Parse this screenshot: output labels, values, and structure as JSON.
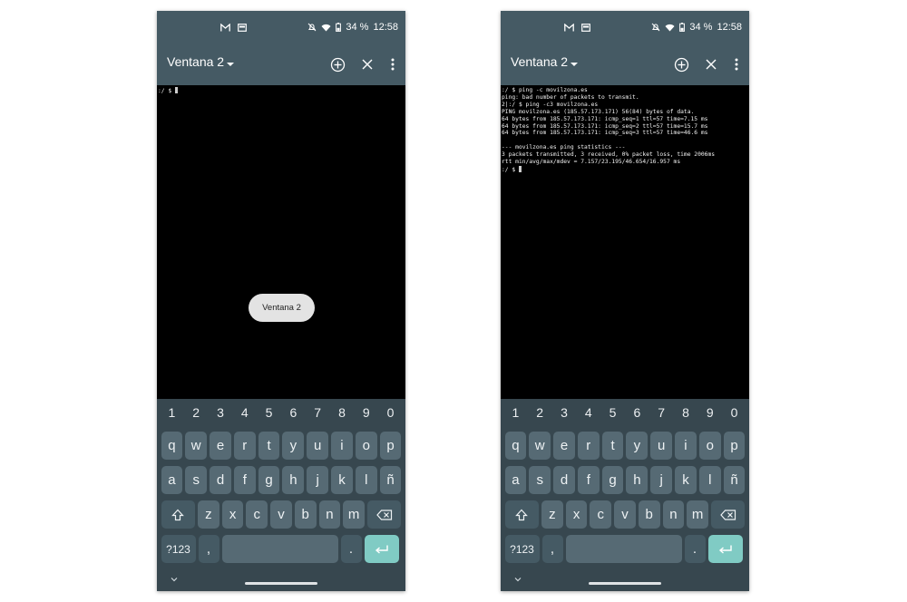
{
  "status_bar": {
    "battery": "34 %",
    "time": "12:58"
  },
  "toolbar": {
    "title": "Ventana 2"
  },
  "left_phone": {
    "terminal_lines": [
      ":/ $ "
    ],
    "toast": "Ventana 2"
  },
  "right_phone": {
    "terminal_lines": [
      ":/ $ ping -c movilzona.es",
      "ping: bad number of packets to transmit.",
      "2|:/ $ ping -c3 movilzona.es",
      "PING movilzona.es (185.57.173.171) 56(84) bytes of data.",
      "64 bytes from 185.57.173.171: icmp_seq=1 ttl=57 time=7.15 ms",
      "64 bytes from 185.57.173.171: icmp_seq=2 ttl=57 time=15.7 ms",
      "64 bytes from 185.57.173.171: icmp_seq=3 ttl=57 time=46.6 ms",
      "",
      "--- movilzona.es ping statistics ---",
      "3 packets transmitted, 3 received, 0% packet loss, time 2006ms",
      "rtt min/avg/max/mdev = 7.157/23.195/46.654/16.957 ms",
      ":/ $ "
    ]
  },
  "keyboard": {
    "numbers": [
      "1",
      "2",
      "3",
      "4",
      "5",
      "6",
      "7",
      "8",
      "9",
      "0"
    ],
    "row1": [
      "q",
      "w",
      "e",
      "r",
      "t",
      "y",
      "u",
      "i",
      "o",
      "p"
    ],
    "row2": [
      "a",
      "s",
      "d",
      "f",
      "g",
      "h",
      "j",
      "k",
      "l",
      "ñ"
    ],
    "row3": [
      "z",
      "x",
      "c",
      "v",
      "b",
      "n",
      "m"
    ],
    "sym_label": "?123",
    "comma": ",",
    "period": "."
  },
  "icons": {
    "status": [
      "gmail-icon",
      "screen-icon",
      "mute-icon",
      "wifi-icon",
      "battery-icon"
    ],
    "toolbar": [
      "dropdown-caret-icon",
      "add-window-icon",
      "close-window-icon",
      "more-options-icon"
    ],
    "keyboard": [
      "shift-icon",
      "backspace-icon",
      "enter-icon"
    ],
    "nav": [
      "chevron-down-icon",
      "gesture-handle"
    ]
  },
  "colors": {
    "toolbar": "#455a64",
    "keyboard": "#37474f",
    "key": "#566a74",
    "enter_key": "#80cbc4",
    "terminal_bg": "#000000"
  }
}
